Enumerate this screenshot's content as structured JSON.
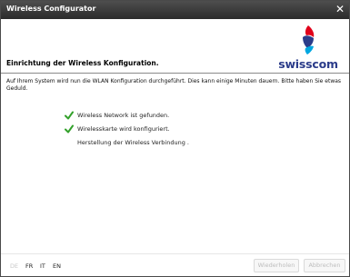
{
  "window": {
    "title": "Wireless Configurator",
    "close_glyph": "✕"
  },
  "header": {
    "heading": "Einrichtung der Wireless Konfiguration.",
    "logo_text": "swisscom",
    "logo_colors": [
      "#e1001a",
      "#2b3c8a",
      "#00a7e1"
    ]
  },
  "content": {
    "intro": "Auf Ihrem System wird nun die WLAN Konfiguration durchgeführt. Dies kann einige Minuten dauern. Bitte haben Sie etwas Geduld.",
    "steps": [
      {
        "text": "Wireless Network ist gefunden.",
        "done": true
      },
      {
        "text": "Wirelesskarte wird konfiguriert.",
        "done": true
      },
      {
        "text": "Herstellung der Wireless Verbindung .",
        "done": false
      }
    ]
  },
  "footer": {
    "languages": [
      {
        "code": "DE",
        "enabled": false
      },
      {
        "code": "FR",
        "enabled": true
      },
      {
        "code": "IT",
        "enabled": true
      },
      {
        "code": "EN",
        "enabled": true
      }
    ],
    "retry_label": "Wiederholen",
    "cancel_label": "Abbrechen"
  },
  "colors": {
    "check": "#33a12b",
    "titlebar": "#3a3a3a"
  }
}
